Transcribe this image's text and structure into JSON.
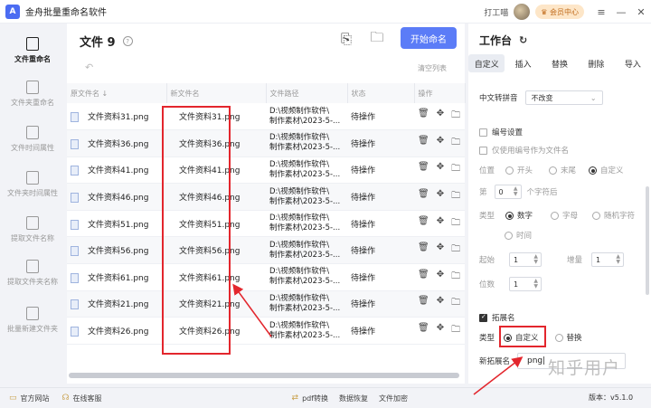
{
  "app": {
    "logo": "A",
    "title": "金舟批量重命名软件",
    "support_link": "打工喵",
    "vip_label": "会员中心"
  },
  "sidebar": {
    "items": [
      {
        "label": "文件重命名",
        "active": true
      },
      {
        "label": "文件夹重命名"
      },
      {
        "label": "文件时间属性"
      },
      {
        "label": "文件夹时间属性"
      },
      {
        "label": "提取文件名称"
      },
      {
        "label": "提取文件夹名称"
      },
      {
        "label": "批量新建文件夹"
      }
    ]
  },
  "main": {
    "title": "文件 9",
    "start_button": "开始命名",
    "clear_list": "清空列表",
    "columns": [
      "原文件名 ↓",
      "新文件名",
      "文件路径",
      "状态",
      "操作"
    ],
    "rows": [
      {
        "orig": "文件资料31.png",
        "new": "文件资料31.png",
        "path1": "D:\\视频制作软件\\",
        "path2": "制作素材\\2023-5-...",
        "status": "待操作"
      },
      {
        "orig": "文件资料36.png",
        "new": "文件资料36.png",
        "path1": "D:\\视频制作软件\\",
        "path2": "制作素材\\2023-5-...",
        "status": "待操作"
      },
      {
        "orig": "文件资料41.png",
        "new": "文件资料41.png",
        "path1": "D:\\视频制作软件\\",
        "path2": "制作素材\\2023-5-...",
        "status": "待操作"
      },
      {
        "orig": "文件资料46.png",
        "new": "文件资料46.png",
        "path1": "D:\\视频制作软件\\",
        "path2": "制作素材\\2023-5-...",
        "status": "待操作"
      },
      {
        "orig": "文件资料51.png",
        "new": "文件资料51.png",
        "path1": "D:\\视频制作软件\\",
        "path2": "制作素材\\2023-5-...",
        "status": "待操作"
      },
      {
        "orig": "文件资料56.png",
        "new": "文件资料56.png",
        "path1": "D:\\视频制作软件\\",
        "path2": "制作素材\\2023-5-...",
        "status": "待操作"
      },
      {
        "orig": "文件资料61.png",
        "new": "文件资料61.png",
        "path1": "D:\\视频制作软件\\",
        "path2": "制作素材\\2023-5-...",
        "status": "待操作"
      },
      {
        "orig": "文件资料21.png",
        "new": "文件资料21.png",
        "path1": "D:\\视频制作软件\\",
        "path2": "制作素材\\2023-5-...",
        "status": "待操作"
      },
      {
        "orig": "文件资料26.png",
        "new": "文件资料26.png",
        "path1": "D:\\视频制作软件\\",
        "path2": "制作素材\\2023-5-...",
        "status": "待操作"
      }
    ]
  },
  "panel": {
    "title": "工作台",
    "tabs": [
      "自定义",
      "插入",
      "替换",
      "删除",
      "导入"
    ],
    "pinyin_label": "中文转拼音",
    "pinyin_value": "不改变",
    "numbering": "编号设置",
    "use_number_only": "仅使用编号作为文件名",
    "position_label": "位置",
    "position_opts": [
      "开头",
      "末尾",
      "自定义"
    ],
    "at_label": "第",
    "at_value": "0",
    "after_chars": "个字符后",
    "type_label": "类型",
    "type_opts": [
      "数字",
      "字母",
      "随机字符",
      "时间"
    ],
    "start_label": "起始",
    "start_value": "1",
    "step_label": "增量",
    "step_value": "1",
    "digits_label": "位数",
    "digits_value": "1",
    "ext_section": "拓展名",
    "ext_type_label": "类型",
    "ext_opts": [
      "自定义",
      "替换"
    ],
    "new_ext_label": "新拓展名",
    "new_ext_value": "png"
  },
  "footer": {
    "items": [
      "官方网站",
      "在线客服"
    ],
    "tools": [
      "pdf转换",
      "数据恢复",
      "文件加密"
    ],
    "version": "版本：v5.1.0"
  },
  "watermark": "知乎用户",
  "colors": {
    "accent": "#5b7cf7",
    "highlight": "#e3262d"
  }
}
